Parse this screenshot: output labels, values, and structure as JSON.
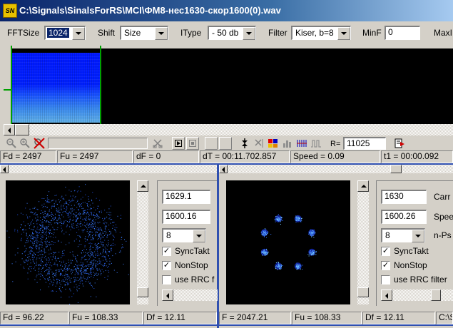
{
  "title": "C:\\Signals\\SinalsForRS\\MCI\\ФМ8-нес1630-скор1600(0).wav",
  "app_icon_text": "SN",
  "toolbar": {
    "fftsize_label": "FFTSize",
    "fftsize_value": "1024",
    "shift_label": "Shift",
    "shift_value": "Size",
    "itype_label": "IType",
    "itype_value": "- 50 db",
    "filter_label": "Filter",
    "filter_value": "Kiser, b=8",
    "minf_label": "MinF",
    "minf_value": "0",
    "maxf_label": "MaxI"
  },
  "controls": {
    "rate_label": "R=",
    "rate_value": "11025"
  },
  "status": {
    "fd": "Fd = 2497",
    "fu": "Fu = 2497",
    "df": "dF = 0",
    "dt": "dT = 00:11.702.857",
    "speed": "Speed = 0.09",
    "t1": "t1 = 00:00.092"
  },
  "left_panel": {
    "field1": "1629.1",
    "field2": "1600.16",
    "select": "8",
    "synctakt": "SyncTakt",
    "nonstop": "NonStop",
    "use_rrc": "use RRC f",
    "status_fd": "Fd = 96.22",
    "status_fu": "Fu = 108.33",
    "status_df": "Df = 12.11"
  },
  "right_panel": {
    "field1": "1630",
    "field1_label": "Carr",
    "field2": "1600.26",
    "field2_label": "Spee",
    "select": "8",
    "select_label": "n-Ps",
    "synctakt": "SyncTakt",
    "nonstop": "NonStop",
    "use_rrc": "use RRC filter",
    "status_f": "F = 2047.21",
    "status_fu": "Fu = 108.33",
    "status_df": "Df = 12.11",
    "status_extra": "C:\\S"
  },
  "checkbox_mark": "✓",
  "colors": {
    "title_start": "#0a246a",
    "title_end": "#a6caf0",
    "face": "#d4d0c8",
    "spectrogram_blue": "#0022ff",
    "constellation": "#3a7bff",
    "panel_divider": "#3050b0"
  },
  "constellation": {
    "points": 8
  }
}
